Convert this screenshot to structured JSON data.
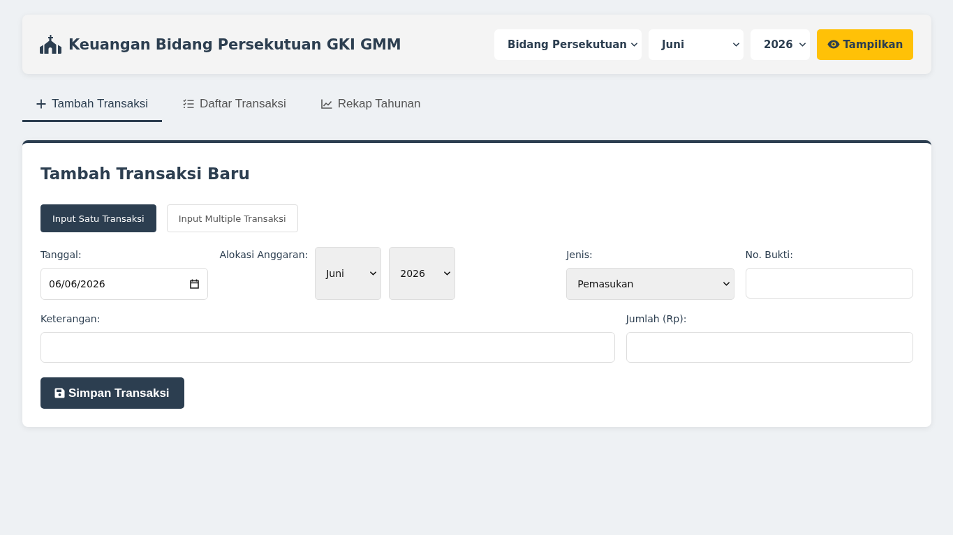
{
  "header": {
    "title": "Keuangan Bidang Persekutuan GKI GMM",
    "filters": [
      {
        "value": "Bidang Persekutuan"
      },
      {
        "value": "Juni"
      },
      {
        "value": "2026"
      }
    ],
    "button": "Tampilkan"
  },
  "tabs": [
    {
      "label": "Tambah Transaksi",
      "selected": true
    },
    {
      "label": "Daftar Transaksi",
      "selected": false
    },
    {
      "label": "Rekap Tahunan",
      "selected": false
    }
  ],
  "form": {
    "title": "Tambah Transaksi Baru",
    "modes": [
      {
        "label": "Input Satu Transaksi",
        "selected": true
      },
      {
        "label": "Input Multiple Transaksi",
        "selected": false
      }
    ],
    "rows": [
      {
        "fields": [
          {
            "kind": "date",
            "label": "Tanggal:",
            "value": "06/06/2026"
          },
          {
            "kind": "selects",
            "label": "Alokasi Anggaran:",
            "values": [
              "Juni",
              "2026"
            ]
          },
          {
            "kind": "select",
            "label": "Jenis:",
            "value": "Pemasukan"
          },
          {
            "kind": "text",
            "label": "No. Bukti:"
          }
        ]
      },
      {
        "fields": [
          {
            "kind": "text",
            "label": "Keterangan:"
          },
          {
            "kind": "text",
            "label": "Jumlah (Rp):"
          }
        ]
      }
    ],
    "submit": "Simpan Transaksi"
  }
}
